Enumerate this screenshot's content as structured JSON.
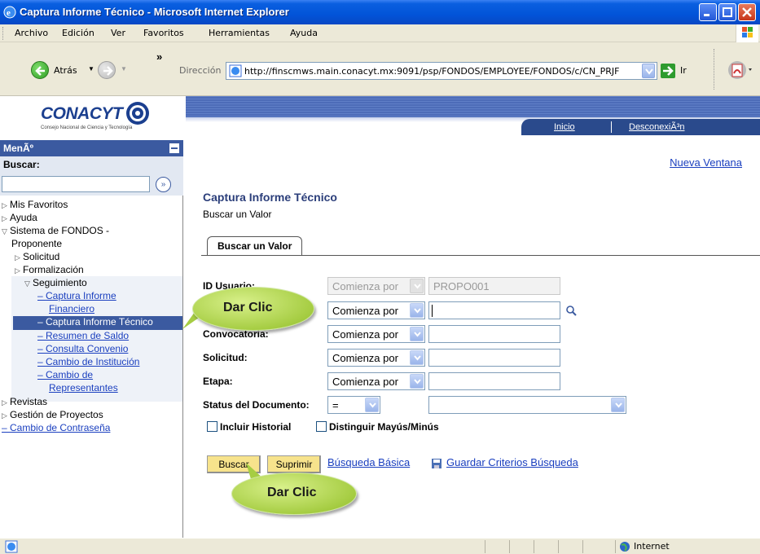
{
  "window": {
    "title": "Captura Informe Técnico - Microsoft Internet Explorer"
  },
  "menubar": {
    "items": [
      "Archivo",
      "Edición",
      "Ver",
      "Favoritos",
      "Herramientas",
      "Ayuda"
    ]
  },
  "toolbar": {
    "back_label": "Atrás",
    "more": "»",
    "address_label": "Dirección",
    "url": "http://finscmws.main.conacyt.mx:9091/psp/FONDOS/EMPLOYEE/FONDOS/c/CN_PRJF",
    "go_label": "Ir"
  },
  "header": {
    "logo_text": "CONACYT",
    "logo_sub": "Consejo Nacional de Ciencia y Tecnología",
    "nav_inicio": "Inicio",
    "nav_desconexion": "DesconexiÃ³n"
  },
  "sidebar": {
    "menu_title": "MenÃº",
    "search_label": "Buscar:",
    "search_go": "»",
    "items": [
      "Mis Favoritos",
      "Ayuda",
      "Sistema de FONDOS -",
      "Proponente",
      "Solicitud",
      "Formalización",
      "Seguimiento",
      "Captura Informe",
      "Financiero",
      "Captura Informe Técnico",
      "Resumen de Saldo",
      "Consulta Convenio",
      "Cambio de Institución",
      "Cambio de",
      "Representantes",
      "Revistas",
      "Gestión de Proyectos",
      "Cambio de Contraseña"
    ]
  },
  "main": {
    "nueva_ventana": "Nueva Ventana",
    "title": "Captura Informe Técnico",
    "subtitle": "Buscar un Valor",
    "tab": "Buscar un Valor",
    "fields": {
      "id_usuario": {
        "label": "ID Usuario:",
        "op": "Comienza por",
        "value": "PROPO001"
      },
      "proyecto": {
        "op": "Comienza por",
        "value": ""
      },
      "convocatoria": {
        "label": "Convocatoria:",
        "op": "Comienza por",
        "value": ""
      },
      "solicitud": {
        "label": "Solicitud:",
        "op": "Comienza por",
        "value": ""
      },
      "etapa": {
        "label": "Etapa:",
        "op": "Comienza por",
        "value": ""
      },
      "status": {
        "label": "Status del Documento:",
        "op": "=",
        "value": ""
      }
    },
    "incluir_historial": "Incluir Historial",
    "distinguir": "Distinguir Mayús/Minús",
    "btn_buscar": "Buscar",
    "btn_suprimir": "Suprimir",
    "link_busqueda_basica": "Búsqueda Básica",
    "link_guardar": "Guardar Criterios Búsqueda"
  },
  "callouts": {
    "first": "Dar Clic",
    "second": "Dar Clic"
  },
  "statusbar": {
    "zone": "Internet"
  },
  "colors": {
    "xp_blue": "#0254d8",
    "accent": "#3b5aa0",
    "link": "#1a3fbf",
    "callout": "#a6cd43",
    "button": "#f7e38c"
  }
}
